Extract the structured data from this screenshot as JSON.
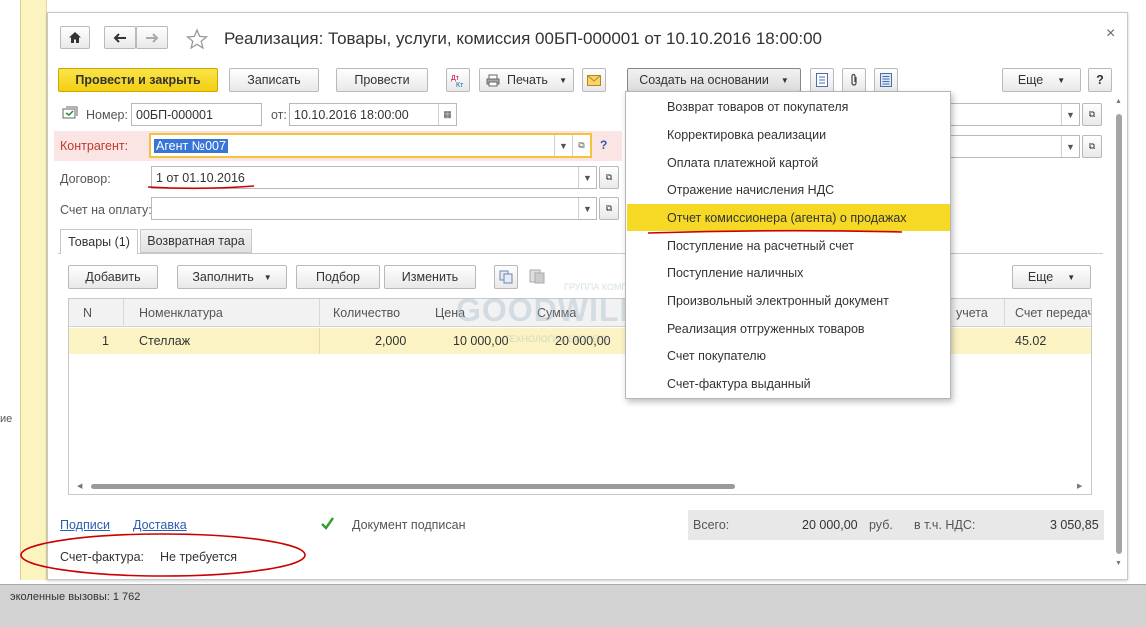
{
  "window": {
    "title": "Реализация: Товары, услуги, комиссия 00БП-000001 от 10.10.2016 18:00:00",
    "close_glyph": "×"
  },
  "toolbar": {
    "post_close": "Провести и закрыть",
    "save": "Записать",
    "post": "Провести",
    "print": "Печать",
    "create_based": "Создать на основании",
    "more": "Еще",
    "help": "?"
  },
  "create_menu": {
    "items": [
      "Возврат товаров от покупателя",
      "Корректировка реализации",
      "Оплата платежной картой",
      "Отражение начисления НДС",
      "Отчет комиссионера (агента) о продажах",
      "Поступление на расчетный счет",
      "Поступление наличных",
      "Произвольный электронный документ",
      "Реализация отгруженных товаров",
      "Счет покупателю",
      "Счет-фактура выданный"
    ],
    "highlighted_index": 4
  },
  "form": {
    "number_label": "Номер:",
    "number_value": "00БП-000001",
    "date_label": "от:",
    "date_value": "10.10.2016 18:00:00",
    "counterparty_label": "Контрагент:",
    "counterparty_value": "Агент №007",
    "contract_label": "Договор:",
    "contract_value": "1 от 01.10.2016",
    "invoice_label": "Счет на оплату:",
    "invoice_value": ""
  },
  "tabs": [
    {
      "label": "Товары (1)",
      "active": true
    },
    {
      "label": "Возвратная тара",
      "active": false
    }
  ],
  "table_toolbar": {
    "add": "Добавить",
    "fill": "Заполнить",
    "pick": "Подбор",
    "change": "Изменить",
    "more": "Еще"
  },
  "table": {
    "columns": [
      "N",
      "Номенклатура",
      "Количество",
      "Цена",
      "Сумма",
      "учета",
      "Счет передачи"
    ],
    "rows": [
      {
        "n": "1",
        "item": "Стеллаж",
        "qty": "2,000",
        "price": "10 000,00",
        "sum": "20 000,00",
        "account": "",
        "transfer": "45.02"
      }
    ]
  },
  "footer": {
    "signatures_link": "Подписи",
    "delivery_link": "Доставка",
    "signed_label": "Документ подписан",
    "signed": true,
    "total_label": "Всего:",
    "total_value": "20 000,00",
    "currency": "руб.",
    "vat_label": "в т.ч. НДС:",
    "vat_value": "3 050,85",
    "invoice_label": "Счет-фактура:",
    "invoice_value": "Не требуется"
  },
  "left_panel": {
    "fragment": "ие"
  },
  "status_bar": {
    "text": "эколенные вызовы: 1 762"
  },
  "watermark": {
    "brand": "GOODWILL",
    "line1": "ГРУППА КОМПАНИЙ",
    "line2": "ТЕХНОЛОГИИ БИЗНЕСА"
  },
  "colors": {
    "accent_yellow": "#f5d924",
    "highlight_red": "#cc0000",
    "counterparty_bg": "#fbe4e4",
    "row_highlight": "#fbf3c4",
    "link": "#2a5db0"
  }
}
